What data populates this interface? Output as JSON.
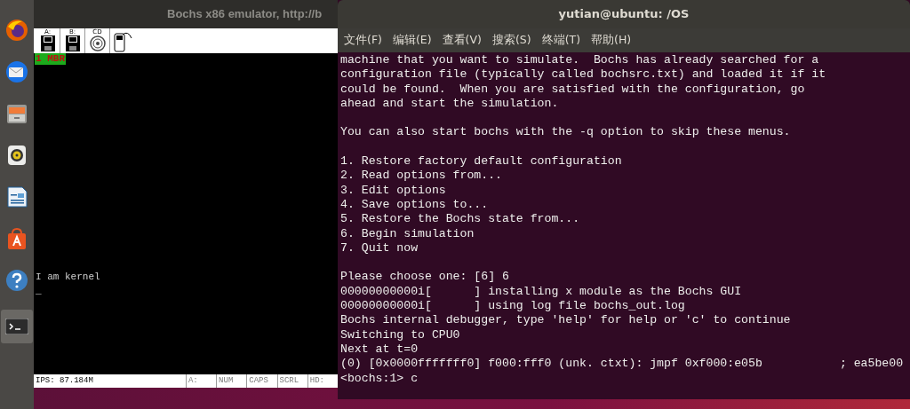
{
  "bochs": {
    "title": "Bochs x86 emulator, http://b",
    "toolbar": [
      "A:",
      "B:",
      "CD"
    ],
    "screen_badge": "1 MBR",
    "screen_lines": [
      "I am kernel",
      "_"
    ],
    "status_bar": [
      "IPS: 87.184M",
      "A:",
      "NUM",
      "CAPS",
      "SCRL",
      "HD:"
    ]
  },
  "terminal": {
    "title": "yutian@ubuntu: /OS",
    "menu": [
      "文件(F)",
      "编辑(E)",
      "查看(V)",
      "搜索(S)",
      "终端(T)",
      "帮助(H)"
    ],
    "blocks": [
      [
        "machine that you want to simulate.  Bochs has already searched for a",
        "configuration file (typically called bochsrc.txt) and loaded it if it",
        "could be found.  When you are satisfied with the configuration, go",
        "ahead and start the simulation."
      ],
      [
        "You can also start bochs with the -q option to skip these menus."
      ],
      [
        "1. Restore factory default configuration",
        "2. Read options from...",
        "3. Edit options",
        "4. Save options to...",
        "5. Restore the Bochs state from...",
        "6. Begin simulation",
        "7. Quit now"
      ],
      [
        "Please choose one: [6] 6",
        "00000000000i[      ] installing x module as the Bochs GUI",
        "00000000000i[      ] using log file bochs_out.log",
        "Bochs internal debugger, type 'help' for help or 'c' to continue",
        "Switching to CPU0",
        "Next at t=0",
        "(0) [0x0000fffffff0] f000:fff0 (unk. ctxt): jmpf 0xf000:e05b           ; ea5be00",
        "<bochs:1> c"
      ]
    ]
  }
}
